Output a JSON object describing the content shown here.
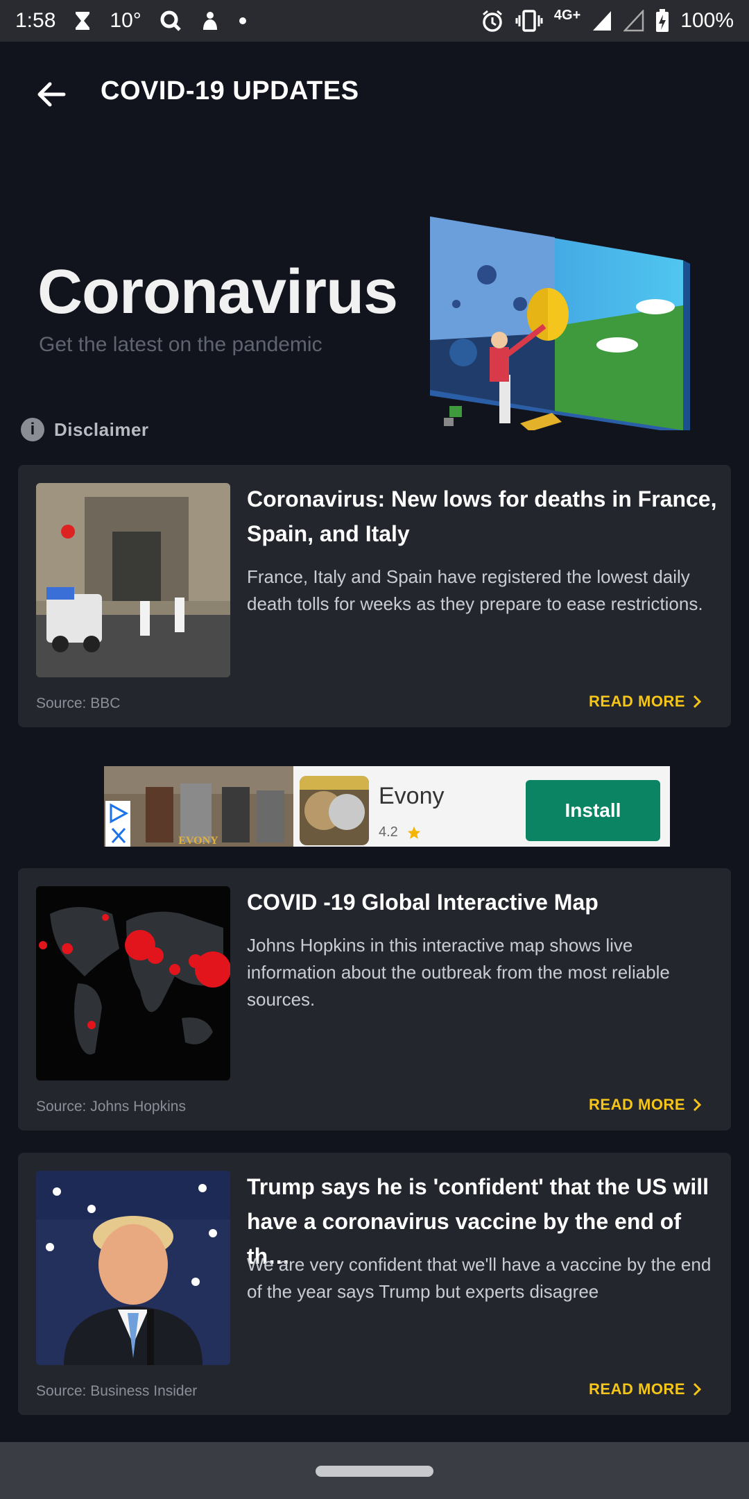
{
  "status_bar": {
    "time": "1:58",
    "temperature": "10°",
    "battery": "100%",
    "network": "4G+",
    "icons": [
      "hourglass-icon",
      "search-icon",
      "app-icon",
      "dot-icon",
      "alarm-icon",
      "vibrate-icon",
      "signal-icon",
      "signal-empty-icon",
      "battery-charging-icon"
    ]
  },
  "app_bar": {
    "back_icon": "arrow-left-icon",
    "title": "COVID-19 UPDATES"
  },
  "hero": {
    "title": "Coronavirus",
    "subtitle": "Get the latest on the pandemic"
  },
  "disclaimer": {
    "icon": "info-icon",
    "icon_glyph": "i",
    "label": "Disclaimer"
  },
  "articles": [
    {
      "title": "Coronavirus: New lows for deaths in France, Spain, and Italy",
      "description": "France, Italy and Spain have registered the lowest daily death tolls for weeks as they prepare to ease restrictions.",
      "source": "Source: BBC",
      "action": "READ MORE"
    },
    {
      "title": "COVID -19 Global Interactive Map",
      "description": "Johns Hopkins in this interactive map shows live information about the outbreak from the most reliable sources.",
      "source": "Source: Johns Hopkins",
      "action": "READ MORE"
    },
    {
      "title": "Trump says he is 'confident' that the US will have a coronavirus vaccine by the end of th…",
      "description": "We are very confident that we'll have a vaccine by the end  of the year says Trump but experts disagree",
      "source": "Source: Business Insider",
      "action": "READ MORE"
    }
  ],
  "ad": {
    "app_name": "Evony",
    "rating": "4.2",
    "install_label": "Install",
    "banner_text": "EVONY"
  },
  "colors": {
    "background": "#11141c",
    "card": "#24262e",
    "accent": "#f5c518",
    "install": "#0a8462"
  }
}
